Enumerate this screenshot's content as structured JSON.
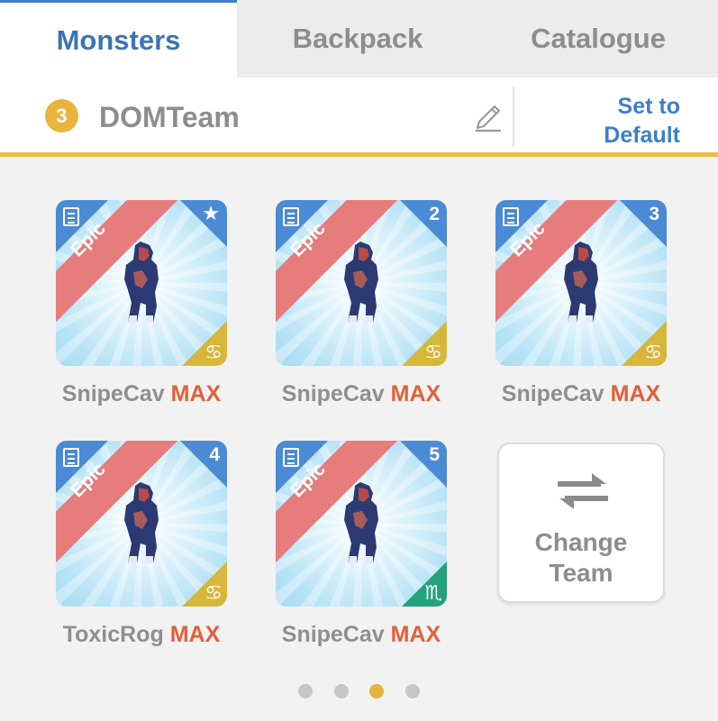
{
  "tabs": [
    {
      "label": "Monsters",
      "active": true
    },
    {
      "label": "Backpack",
      "active": false
    },
    {
      "label": "Catalogue",
      "active": false
    }
  ],
  "team": {
    "number": "3",
    "name": "DOMTeam",
    "set_default_line1": "Set to",
    "set_default_line2": "Default"
  },
  "cards": [
    {
      "rarity": "Epic",
      "slot": "★",
      "slot_icon": "star-icon",
      "zodiac": "♋",
      "zodiac_name": "cancer-icon",
      "name": "SnipeCav",
      "level": "MAX"
    },
    {
      "rarity": "Epic",
      "slot": "2",
      "zodiac": "♋",
      "zodiac_name": "cancer-icon",
      "name": "SnipeCav",
      "level": "MAX"
    },
    {
      "rarity": "Epic",
      "slot": "3",
      "zodiac": "♋",
      "zodiac_name": "cancer-icon",
      "name": "SnipeCav",
      "level": "MAX"
    },
    {
      "rarity": "Epic",
      "slot": "4",
      "zodiac": "♋",
      "zodiac_name": "cancer-icon",
      "name": "ToxicRog",
      "level": "MAX"
    },
    {
      "rarity": "Epic",
      "slot": "5",
      "zodiac": "♏",
      "zodiac_name": "scorpio-icon",
      "name": "SnipeCav",
      "level": "MAX"
    }
  ],
  "change_team": {
    "line1": "Change",
    "line2": "Team"
  },
  "pagination": {
    "pages": 4,
    "active_index": 2
  },
  "colors": {
    "accent_blue": "#3d73b4",
    "team_gold": "#e7b43e",
    "epic_ribbon": "#e67c7c",
    "max_orange": "#e0603a",
    "zodiac_gold": "#d7b73b",
    "zodiac_green": "#23a27c"
  }
}
